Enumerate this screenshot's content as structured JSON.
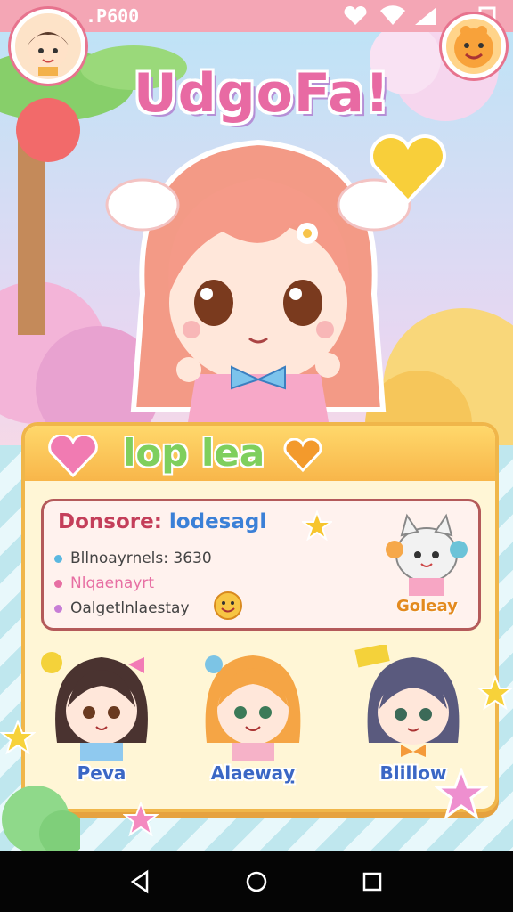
{
  "status_bar": {
    "time": ".P600"
  },
  "app": {
    "title": "UdgoFa!"
  },
  "card": {
    "title": "lop lea",
    "info": {
      "title_label": "Donsore:",
      "title_value": "lodesagl",
      "lines": [
        {
          "text": "Bllnoayrnels: 3630",
          "color": "#5bb8e0"
        },
        {
          "text": "Nlqaenayrt",
          "color": "#e76fa3"
        },
        {
          "text": "Oalgetlnlaestay",
          "color": "#c77dd6"
        }
      ]
    },
    "pet_label": "Goleay",
    "characters": [
      {
        "name": "Peva"
      },
      {
        "name": "Alaewaỵ"
      },
      {
        "name": "Blillow"
      }
    ]
  },
  "colors": {
    "status_bar": "#f4a6b5",
    "accent": "#e86aa3",
    "card_border": "#f0b64a"
  }
}
